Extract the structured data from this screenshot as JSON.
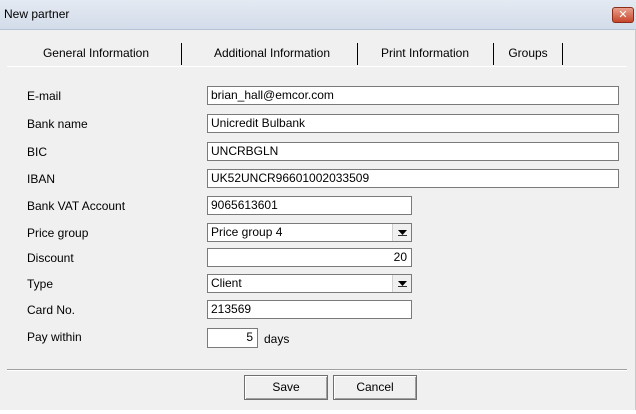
{
  "window": {
    "title": "New partner",
    "close_glyph": "✕"
  },
  "tabs": [
    {
      "label": "General Information"
    },
    {
      "label": "Additional Information"
    },
    {
      "label": "Print Information"
    },
    {
      "label": "Groups"
    }
  ],
  "form": {
    "email": {
      "label": "E-mail",
      "value": "brian_hall@emcor.com"
    },
    "bank_name": {
      "label": "Bank name",
      "value": "Unicredit Bulbank"
    },
    "bic": {
      "label": "BIC",
      "value": "UNCRBGLN"
    },
    "iban": {
      "label": "IBAN",
      "value": "UK52UNCR96601002033509"
    },
    "bank_vat": {
      "label": "Bank VAT Account",
      "value": "9065613601"
    },
    "price_group": {
      "label": "Price group",
      "value": "Price group 4"
    },
    "discount": {
      "label": "Discount",
      "value": "20"
    },
    "type": {
      "label": "Type",
      "value": "Client"
    },
    "card_no": {
      "label": "Card No.",
      "value": "213569"
    },
    "pay_within": {
      "label": "Pay within",
      "value": "5",
      "unit": "days"
    }
  },
  "buttons": {
    "save": "Save",
    "cancel": "Cancel"
  },
  "icons": {
    "close": "close-icon",
    "dropdown": "chevron-down-icon"
  },
  "colors": {
    "close_button": "#c7452b",
    "titlebar": "#dbe3ee"
  }
}
